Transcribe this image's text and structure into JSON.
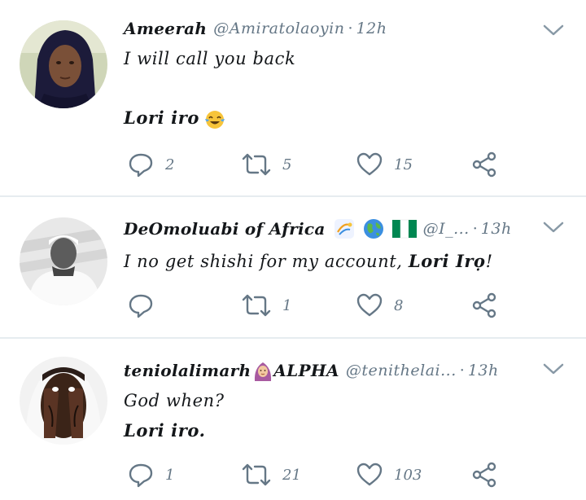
{
  "tweets": [
    {
      "name": "Ameerah",
      "handle": "@Amiratolaoyin",
      "separator": "·",
      "time": "12h",
      "lines": [
        "I will call you back",
        "",
        "Lori iro"
      ],
      "line3_emoji": "face-with-tears-of-joy",
      "replies": "2",
      "retweets": "5",
      "likes": "15"
    },
    {
      "name": "DeOmoluabi of Africa",
      "name_emojis": [
        "dizzy-icon",
        "globe-icon",
        "nigeria-flag-icon"
      ],
      "handle": "@I_...",
      "separator": "·",
      "time": "13h",
      "line_prefix": "I no get shishi for my account, ",
      "line_bold": "Lori Irọ",
      "line_suffix": "!",
      "replies": "",
      "retweets": "1",
      "likes": "8"
    },
    {
      "name": "teniolalimarh",
      "name_emoji": "woman-with-headscarf-icon",
      "name_suffix": " ALPHA",
      "handle": "@tenithelai...",
      "separator": "·",
      "time": "13h",
      "lines": [
        "God when?",
        "Lori iro."
      ],
      "replies": "1",
      "retweets": "21",
      "likes": "103"
    }
  ],
  "colors": {
    "icon": "#657786",
    "divider": "#e6ecf0",
    "text": "#14171a",
    "flag_green": "#008751"
  }
}
